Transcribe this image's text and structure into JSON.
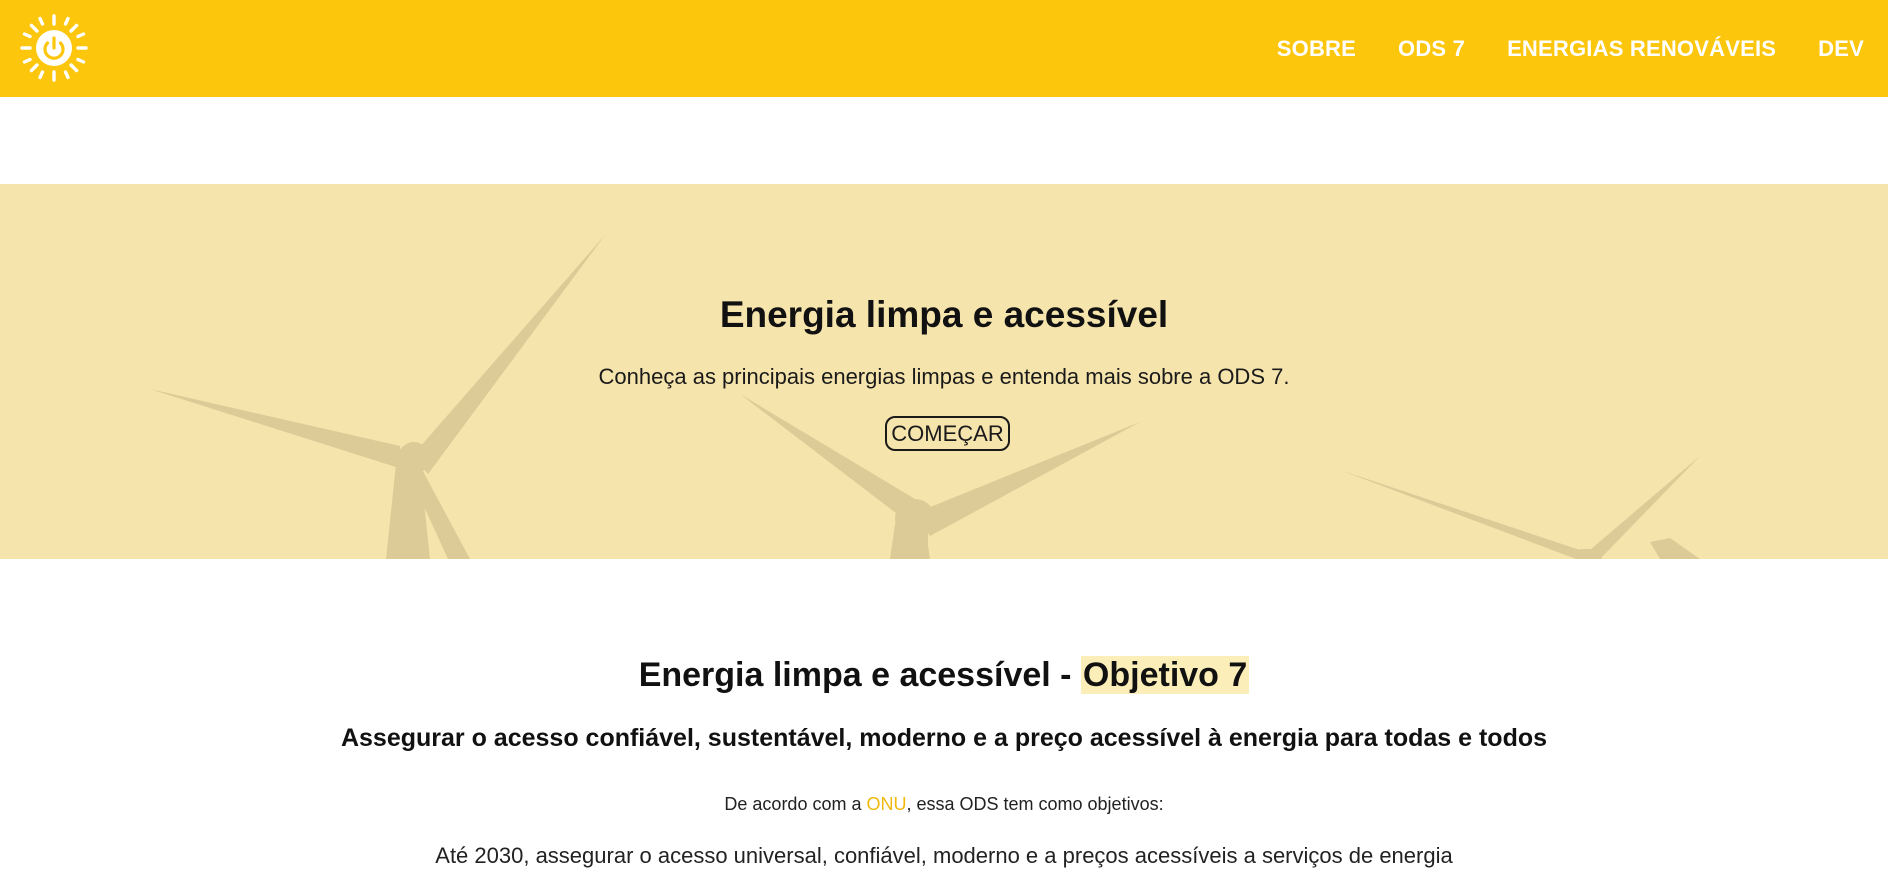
{
  "colors": {
    "brand_yellow": "#fcc60c",
    "hero_background": "#f6e4ad",
    "highlight": "#fbeeb8",
    "link": "#f0b90b"
  },
  "header": {
    "logo_icon": "sun-power-icon",
    "nav": [
      {
        "label": "SOBRE"
      },
      {
        "label": "ODS 7"
      },
      {
        "label": "ENERGIAS RENOVÁVEIS"
      },
      {
        "label": "DEV"
      }
    ]
  },
  "hero": {
    "background_icon": "wind-turbines-image",
    "title": "Energia limpa e acessível",
    "subtitle": "Conheça as principais energias limpas e entenda mais sobre a ODS 7.",
    "button_label": "COMEÇAR"
  },
  "goal_section": {
    "title_prefix": "Energia limpa e acessível - ",
    "title_highlight": "Objetivo 7",
    "subtitle": "Assegurar o acesso confiável, sustentável, moderno e a preço acessível à energia para todas e todos",
    "intro_before": "De acordo com a ",
    "intro_link": "ONU",
    "intro_after": ", essa ODS tem como objetivos:",
    "goals": [
      "Até 2030, assegurar o acesso universal, confiável, moderno e a preços acessíveis a serviços de energia"
    ]
  }
}
